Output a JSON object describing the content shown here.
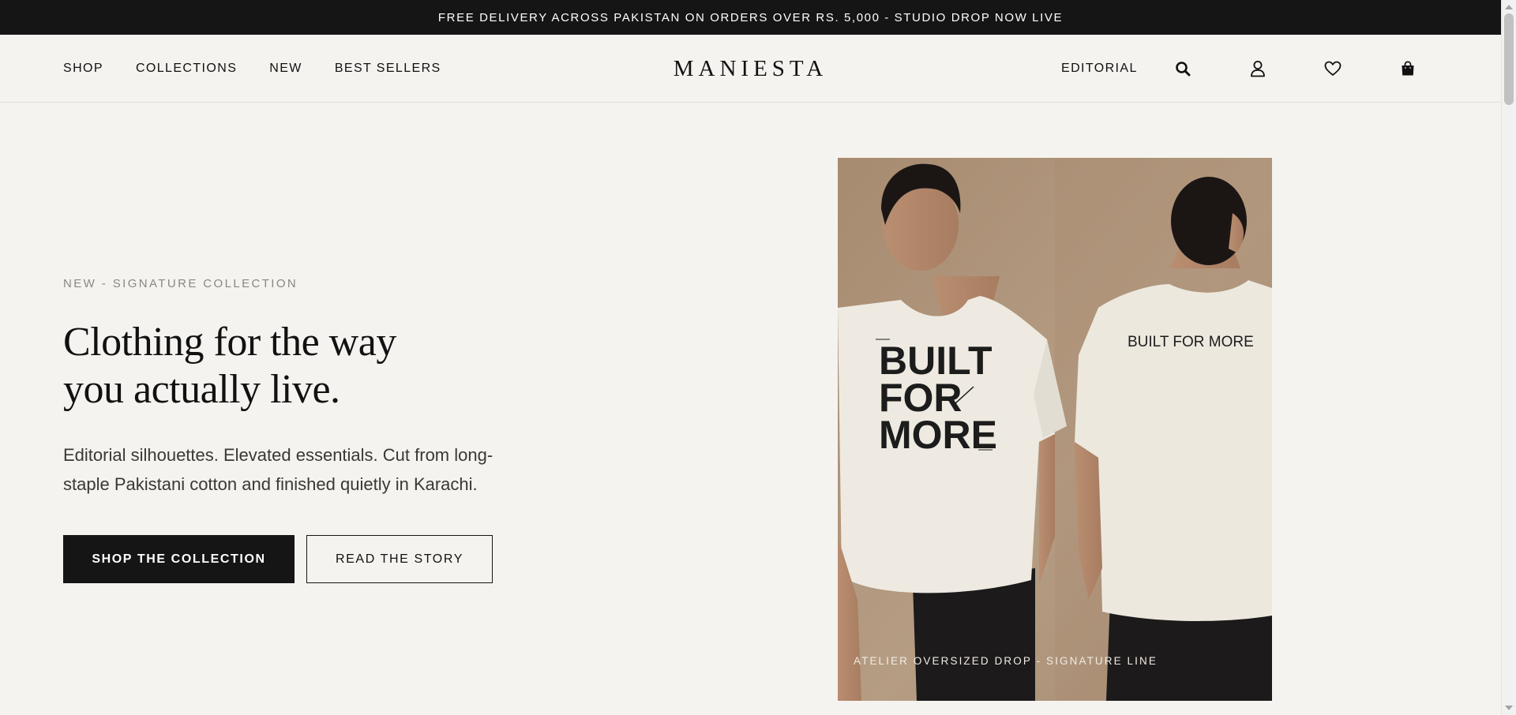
{
  "announcement": {
    "text": "FREE DELIVERY ACROSS PAKISTAN ON ORDERS OVER RS. 5,000 - STUDIO DROP NOW LIVE"
  },
  "header": {
    "nav_left": [
      "SHOP",
      "COLLECTIONS",
      "NEW",
      "BEST SELLERS"
    ],
    "logo": "MANIESTA",
    "nav_right": [
      "EDITORIAL"
    ],
    "icons": [
      "search-icon",
      "account-icon",
      "wishlist-icon",
      "cart-icon"
    ]
  },
  "hero": {
    "eyebrow": "NEW - SIGNATURE COLLECTION",
    "headline_line1": "Clothing for the way",
    "headline_line2": "you actually live.",
    "subcopy": "Editorial silhouettes. Elevated essentials. Cut from long-staple Pakistani cotton and finished quietly in Karachi.",
    "primary_cta": "SHOP THE COLLECTION",
    "secondary_cta": "READ THE STORY",
    "image": {
      "front_print": [
        "BUILT",
        "FOR",
        "MORE"
      ],
      "back_print": "BUILT FOR MORE",
      "caption": "ATELIER OVERSIZED DROP - SIGNATURE LINE"
    }
  },
  "colors": {
    "background": "#f5f3ef",
    "announcement_bg": "#151515",
    "primary_button": "#151515",
    "image_backdrop": "#a88d74"
  }
}
